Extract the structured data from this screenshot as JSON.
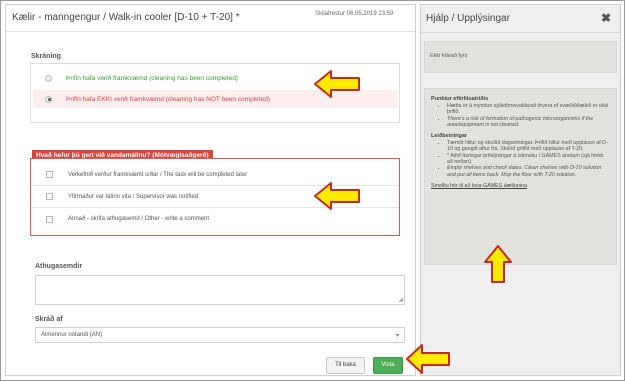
{
  "modal": {
    "title": "Kælir - manngengur / Walk-in cooler [D-10 + T-20] *",
    "due": "Skilafrestur 06.05.2019 23:59"
  },
  "registration": {
    "label": "Skráning",
    "options": [
      {
        "label": "Þrifin hafa verið framkvæmd (cleaning has been completed)",
        "selected": false
      },
      {
        "label": "Þrifin hafa EKKI verið framkvæmd (cleaning has NOT been completed)",
        "selected": true
      }
    ]
  },
  "action": {
    "label": "Hvað hefur þú gert við vandamálinu? (Mótvægisaðgerð)",
    "options": [
      {
        "label": "Verkefnið verður framkvæmt síðar / The task will be completed later"
      },
      {
        "label": "Yfirmaður var látinn vita / Supervisor was notified"
      },
      {
        "label": "Annað - skrifa athugasemd / Other - write a comment"
      }
    ]
  },
  "comment": {
    "label": "Athugasemdir",
    "value": ""
  },
  "recorded_by": {
    "label": "Skráð af",
    "value": "Almennur notandi (AN)"
  },
  "buttons": {
    "back": "Til baka",
    "save": "Vista"
  },
  "help": {
    "title": "Hjálp / Upplýsingar",
    "close": "✖",
    "status": "Ekki klárað fyrir",
    "head1": "Punktur eftirlitsatriðis",
    "items1": [
      "Hætta er á myndun sjúkdómsvaldandi örvera ef svæðið/tækið er ekki þrifið.",
      "There's a risk of formation of pathogenic microorganisms if the area/equipment is not cleaned."
    ],
    "head2": "Leiðbeiningar",
    "items2": [
      "Tæmið hillur og skoðið dagsetningar. Þrífið hillur með upplausn af D-10 og gangið aftur frá. Skúrið gólfið með upplausn af T-20.",
      "* Athif ítarlegar þrifalýsingar á íslensku í GÁMES ánetum (sjá hlekk að neðan).",
      "Empty shelves and check dates. Clean shelves with D-10 solution and put all items back. Mop the floor with T-20 solution."
    ],
    "link": "Smelltu hér til að lesa GÁMES áætlunina"
  },
  "colors": {
    "accent_red": "#d9463e",
    "success_green": "#4cae56",
    "arrow_yellow": "#ffea00",
    "arrow_outline": "#c62828"
  }
}
